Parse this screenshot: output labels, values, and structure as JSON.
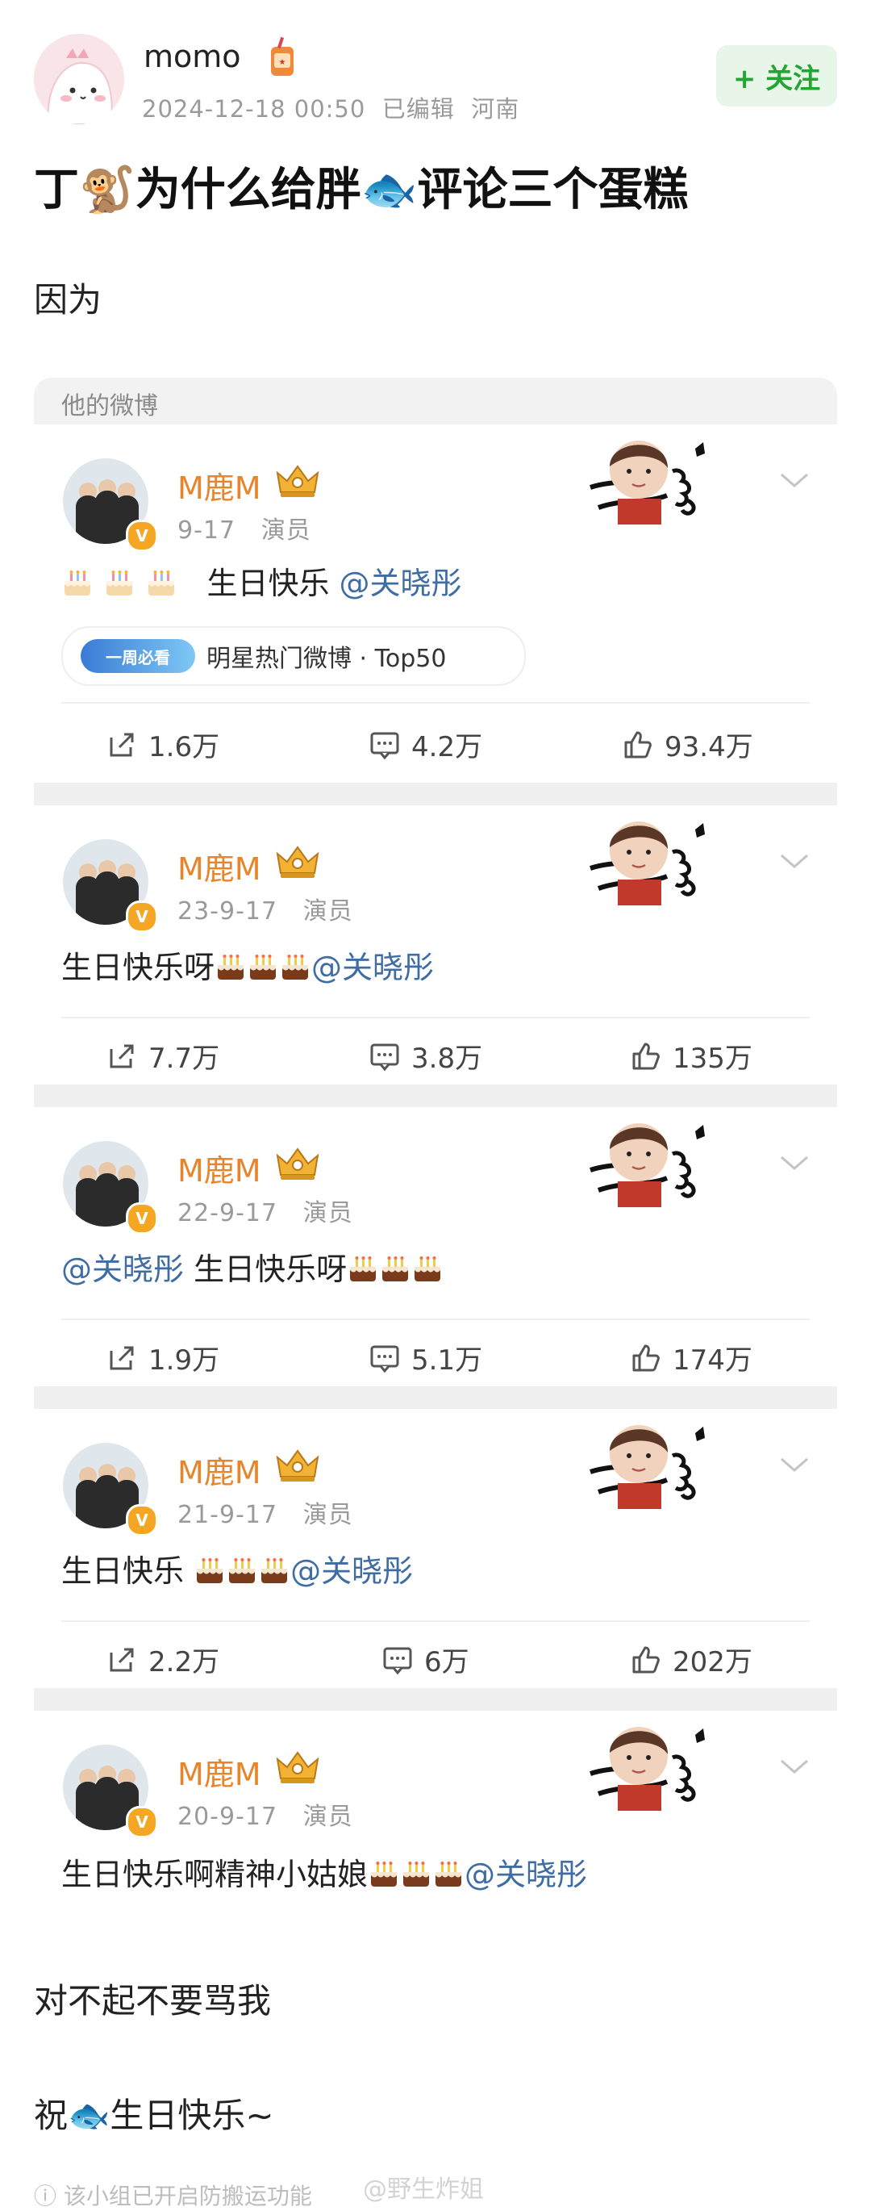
{
  "author": {
    "name": "momo",
    "date": "2024-12-18 00:50",
    "edited": "已编辑",
    "location": "河南",
    "follow_label": "+ 关注"
  },
  "post": {
    "title_parts": [
      "丁",
      "为什么给胖",
      "评论三个蛋糕"
    ],
    "intro": "因为",
    "section_label": "他的微博",
    "outro_1": "对不起不要骂我",
    "outro_2_a": "祝",
    "outro_2_b": "生日快乐~"
  },
  "weibo_posts": [
    {
      "name": "M鹿M",
      "date": "9-17",
      "role": "演员",
      "text_before": "生日快乐 ",
      "text_after": "",
      "mention": "@关晓彤",
      "hot": {
        "logo": "一周必看",
        "label": "明星热门微博 · Top50"
      },
      "stats": {
        "share": "1.6万",
        "comment": "4.2万",
        "like": "93.4万"
      }
    },
    {
      "name": "M鹿M",
      "date": "23-9-17",
      "role": "演员",
      "text_before": "生日快乐呀",
      "text_after": "",
      "mention": "@关晓彤",
      "stats": {
        "share": "7.7万",
        "comment": "3.8万",
        "like": "135万"
      }
    },
    {
      "name": "M鹿M",
      "date": "22-9-17",
      "role": "演员",
      "text_before": "",
      "text_after": " 生日快乐呀",
      "mention": "@关晓彤",
      "stats": {
        "share": "1.9万",
        "comment": "5.1万",
        "like": "174万"
      }
    },
    {
      "name": "M鹿M",
      "date": "21-9-17",
      "role": "演员",
      "text_before": "生日快乐 ",
      "text_after": "",
      "mention": "@关晓彤",
      "stats": {
        "share": "2.2万",
        "comment": "6万",
        "like": "202万"
      }
    },
    {
      "name": "M鹿M",
      "date": "20-9-17",
      "role": "演员",
      "text_before": "生日快乐啊精神小姑娘",
      "text_after": "",
      "mention": "@关晓彤"
    }
  ],
  "footer": {
    "notice": "该小组已开启防搬运功能",
    "watermark": "@野生炸姐"
  },
  "icons": [
    "monkey-icon",
    "fish-icon",
    "cake-icon",
    "crown-icon",
    "share-icon",
    "comment-icon",
    "like-icon",
    "chevron-down-icon",
    "verified-badge-icon"
  ],
  "colors": {
    "accent_name": "#e8852a",
    "mention": "#3f6da3",
    "follow_green": "#22a532"
  }
}
